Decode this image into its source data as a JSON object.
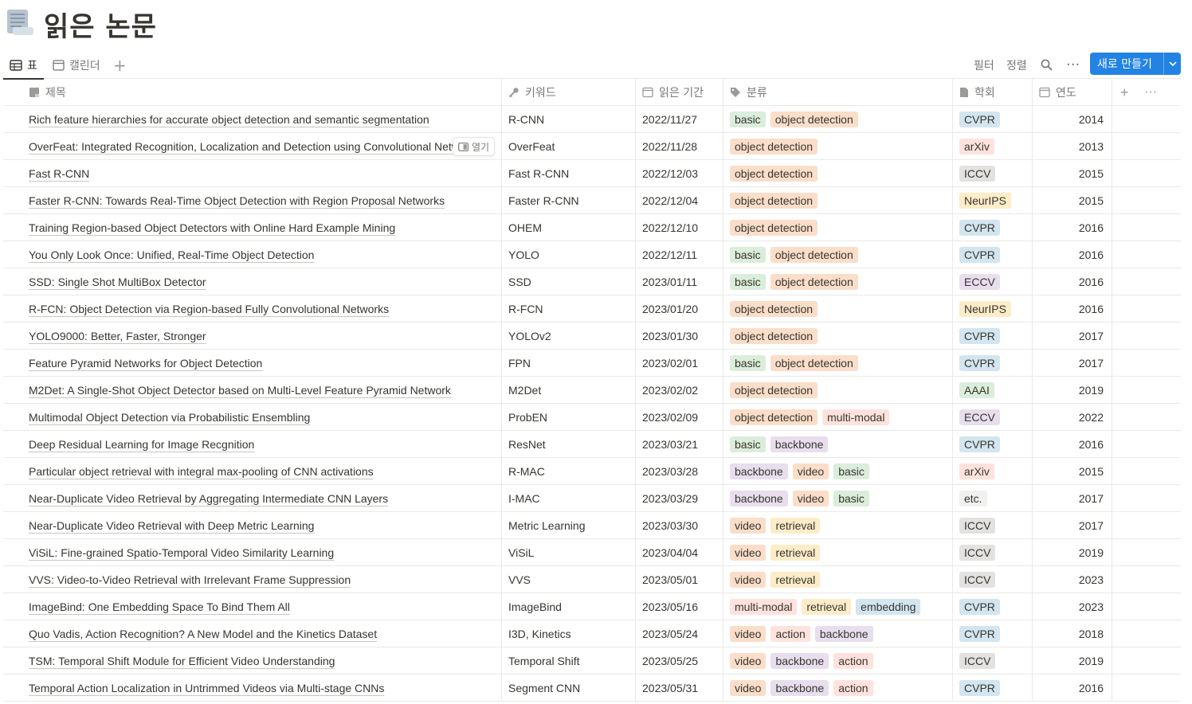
{
  "page": {
    "title": "읽은 논문"
  },
  "views": {
    "tabs": [
      {
        "label": "표",
        "active": true
      },
      {
        "label": "캘린더",
        "active": false
      }
    ],
    "filter_label": "필터",
    "sort_label": "정렬",
    "more_label": "···",
    "new_button_label": "새로 만들기"
  },
  "columns": {
    "title": "제목",
    "keyword": "키워드",
    "date": "읽은 기간",
    "category": "분류",
    "conference": "학회",
    "year": "연도"
  },
  "open_label": "열기",
  "colors": {
    "accent": "#2383e2",
    "basic": "#dbeddb",
    "object detection": "#fadec9",
    "multi-modal": "#ffe2dd",
    "backbone": "#e8deee",
    "video": "#fadec9",
    "retrieval": "#fdecc8",
    "embedding": "#d3e5ef",
    "action": "#ffe2dd",
    "CVPR": "#d3e5ef",
    "arXiv": "#ffe2dd",
    "ICCV": "#e3e2e0",
    "NeurIPS": "#fdecc8",
    "ECCV": "#e8deee",
    "AAAI": "#dbeddb",
    "etc.": "#f1f1ef"
  },
  "rows": [
    {
      "title": "Rich feature hierarchies for accurate object detection and semantic segmentation",
      "keyword": "R-CNN",
      "date": "2022/11/27",
      "tags": [
        "basic",
        "object detection"
      ],
      "conf": "CVPR",
      "year": "2014"
    },
    {
      "title": "OverFeat: Integrated Recognition, Localization and Detection using Convolutional Networks",
      "keyword": "OverFeat",
      "date": "2022/11/28",
      "tags": [
        "object detection"
      ],
      "conf": "arXiv",
      "year": "2013",
      "hover": true
    },
    {
      "title": "Fast R-CNN",
      "keyword": "Fast R-CNN",
      "date": "2022/12/03",
      "tags": [
        "object detection"
      ],
      "conf": "ICCV",
      "year": "2015"
    },
    {
      "title": "Faster R-CNN: Towards Real-Time Object Detection with Region Proposal Networks",
      "keyword": "Faster R-CNN",
      "date": "2022/12/04",
      "tags": [
        "object detection"
      ],
      "conf": "NeurIPS",
      "year": "2015"
    },
    {
      "title": "Training Region-based Object Detectors with Online Hard Example Mining",
      "keyword": "OHEM",
      "date": "2022/12/10",
      "tags": [
        "object detection"
      ],
      "conf": "CVPR",
      "year": "2016"
    },
    {
      "title": "You Only Look Once: Unified, Real-Time Object Detection",
      "keyword": "YOLO",
      "date": "2022/12/11",
      "tags": [
        "basic",
        "object detection"
      ],
      "conf": "CVPR",
      "year": "2016"
    },
    {
      "title": "SSD: Single Shot MultiBox Detector",
      "keyword": "SSD",
      "date": "2023/01/11",
      "tags": [
        "basic",
        "object detection"
      ],
      "conf": "ECCV",
      "year": "2016"
    },
    {
      "title": "R-FCN: Object Detection via Region-based Fully Convolutional Networks",
      "keyword": "R-FCN",
      "date": "2023/01/20",
      "tags": [
        "object detection"
      ],
      "conf": "NeurIPS",
      "year": "2016"
    },
    {
      "title": "YOLO9000: Better, Faster, Stronger",
      "keyword": "YOLOv2",
      "date": "2023/01/30",
      "tags": [
        "object detection"
      ],
      "conf": "CVPR",
      "year": "2017"
    },
    {
      "title": "Feature Pyramid Networks for Object Detection",
      "keyword": "FPN",
      "date": "2023/02/01",
      "tags": [
        "basic",
        "object detection"
      ],
      "conf": "CVPR",
      "year": "2017"
    },
    {
      "title": "M2Det: A Single-Shot Object Detector based on Multi-Level Feature Pyramid Network",
      "keyword": "M2Det",
      "date": "2023/02/02",
      "tags": [
        "object detection"
      ],
      "conf": "AAAI",
      "year": "2019"
    },
    {
      "title": "Multimodal Object Detection via Probabilistic Ensembling",
      "keyword": "ProbEN",
      "date": "2023/02/09",
      "tags": [
        "object detection",
        "multi-modal"
      ],
      "conf": "ECCV",
      "year": "2022"
    },
    {
      "title": "Deep Residual Learning for Image Recgnition",
      "keyword": "ResNet",
      "date": "2023/03/21",
      "tags": [
        "basic",
        "backbone"
      ],
      "conf": "CVPR",
      "year": "2016"
    },
    {
      "title": "Particular object retrieval with integral max-pooling of CNN activations",
      "keyword": "R-MAC",
      "date": "2023/03/28",
      "tags": [
        "backbone",
        "video",
        "basic"
      ],
      "conf": "arXiv",
      "year": "2015"
    },
    {
      "title": "Near-Duplicate Video Retrieval by Aggregating Intermediate CNN Layers",
      "keyword": "I-MAC",
      "date": "2023/03/29",
      "tags": [
        "backbone",
        "video",
        "basic"
      ],
      "conf": "etc.",
      "year": "2017"
    },
    {
      "title": "Near-Duplicate Video Retrieval with Deep Metric Learning",
      "keyword": "Metric Learning",
      "date": "2023/03/30",
      "tags": [
        "video",
        "retrieval"
      ],
      "conf": "ICCV",
      "year": "2017"
    },
    {
      "title": "ViSiL: Fine-grained Spatio-Temporal Video Similarity Learning",
      "keyword": "ViSiL",
      "date": "2023/04/04",
      "tags": [
        "video",
        "retrieval"
      ],
      "conf": "ICCV",
      "year": "2019"
    },
    {
      "title": "VVS: Video-to-Video Retrieval with Irrelevant Frame Suppression",
      "keyword": "VVS",
      "date": "2023/05/01",
      "tags": [
        "video",
        "retrieval"
      ],
      "conf": "ICCV",
      "year": "2023"
    },
    {
      "title": "ImageBind: One Embedding Space To Bind Them All",
      "keyword": "ImageBind",
      "date": "2023/05/16",
      "tags": [
        "multi-modal",
        "retrieval",
        "embedding"
      ],
      "conf": "CVPR",
      "year": "2023"
    },
    {
      "title": "Quo Vadis, Action Recognition? A New Model and the Kinetics Dataset",
      "keyword": "I3D, Kinetics",
      "date": "2023/05/24",
      "tags": [
        "video",
        "action",
        "backbone"
      ],
      "conf": "CVPR",
      "year": "2018"
    },
    {
      "title": "TSM: Temporal Shift Module for Efficient Video Understanding",
      "keyword": "Temporal Shift",
      "date": "2023/05/25",
      "tags": [
        "video",
        "backbone",
        "action"
      ],
      "conf": "ICCV",
      "year": "2019"
    },
    {
      "title": "Temporal Action Localization in Untrimmed Videos via Multi-stage CNNs",
      "keyword": "Segment CNN",
      "date": "2023/05/31",
      "tags": [
        "video",
        "backbone",
        "action"
      ],
      "conf": "CVPR",
      "year": "2016"
    }
  ]
}
